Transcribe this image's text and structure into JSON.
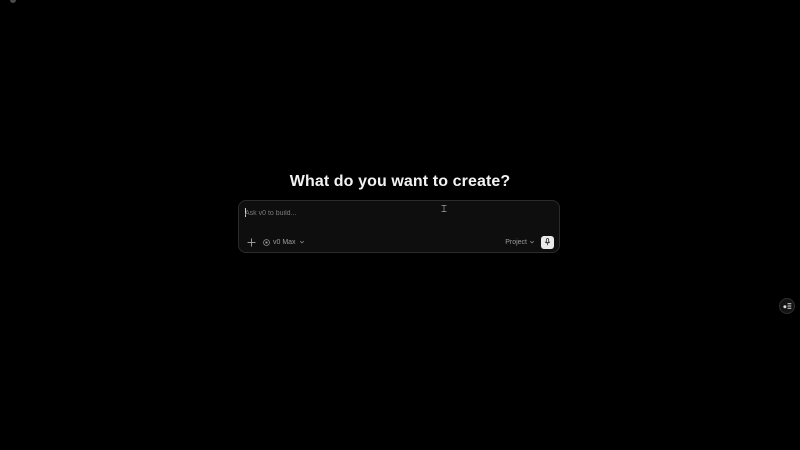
{
  "heading": "What do you want to create?",
  "prompt": {
    "placeholder": "Ask v0 to build...",
    "value": ""
  },
  "toolbar": {
    "add_icon": "plus-icon",
    "model_label": "v0 Max",
    "model_icon": "model-icon",
    "project_label": "Project",
    "mic_icon": "microphone-icon"
  },
  "floating": {
    "feedback_icon": "feedback-icon"
  },
  "colors": {
    "background": "#000000",
    "panel": "#0e0e0e",
    "panel_border": "#2b2b2b",
    "text_primary": "#f2f2f2",
    "text_muted": "#9c9c9c",
    "mic_button": "#e9e9e9"
  }
}
